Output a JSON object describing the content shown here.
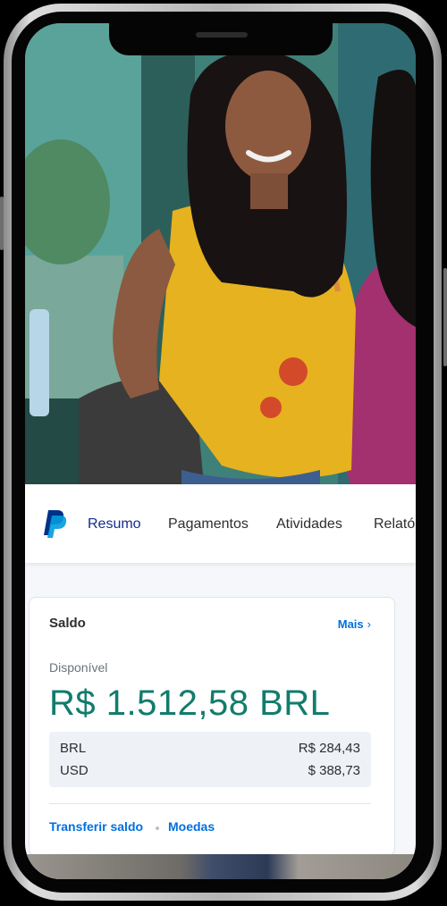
{
  "nav": {
    "tabs": [
      {
        "label": "Resumo"
      },
      {
        "label": "Pagamentos"
      },
      {
        "label": "Atividades"
      },
      {
        "label": "Relató"
      }
    ]
  },
  "balance_card": {
    "title": "Saldo",
    "more_label": "Mais",
    "available_label": "Disponível",
    "total": "R$ 1.512,58 BRL",
    "currencies": [
      {
        "code": "BRL",
        "value": "R$ 284,43"
      },
      {
        "code": "USD",
        "value": "$ 388,73"
      }
    ],
    "links": {
      "transfer": "Transferir saldo",
      "currencies": "Moedas"
    }
  },
  "colors": {
    "paypal_dark": "#003087",
    "paypal_light": "#009cde",
    "amount_green": "#127c6c",
    "link_blue": "#0070e0"
  }
}
